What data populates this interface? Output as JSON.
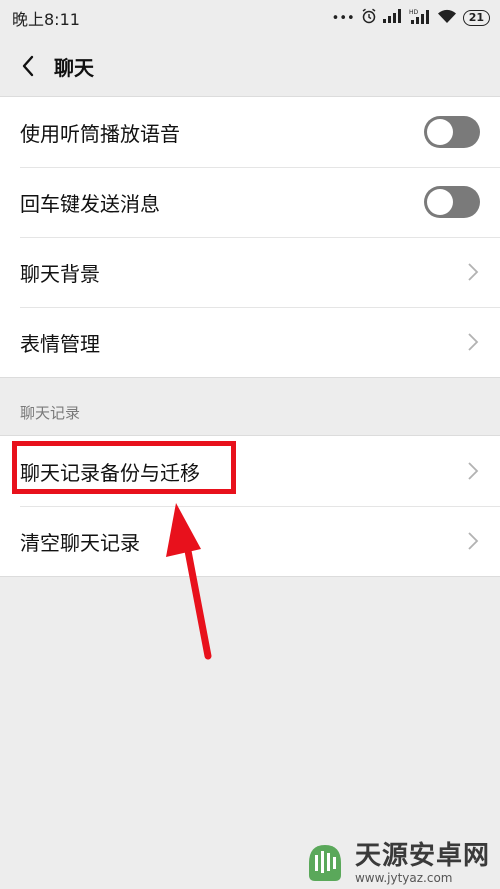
{
  "status_bar": {
    "time": "晚上8:11",
    "dots": "•••",
    "battery": "21"
  },
  "nav": {
    "title": "聊天"
  },
  "settings": {
    "earpiece_label": "使用听筒播放语音",
    "earpiece_on": false,
    "enter_send_label": "回车键发送消息",
    "enter_send_on": false,
    "background_label": "聊天背景",
    "emoji_label": "表情管理"
  },
  "history": {
    "section_title": "聊天记录",
    "backup_label": "聊天记录备份与迁移",
    "clear_label": "清空聊天记录"
  },
  "annotation": {
    "color": "#e8111c"
  },
  "watermark": {
    "title": "天源安卓网",
    "url": "www.jytyaz.com"
  }
}
